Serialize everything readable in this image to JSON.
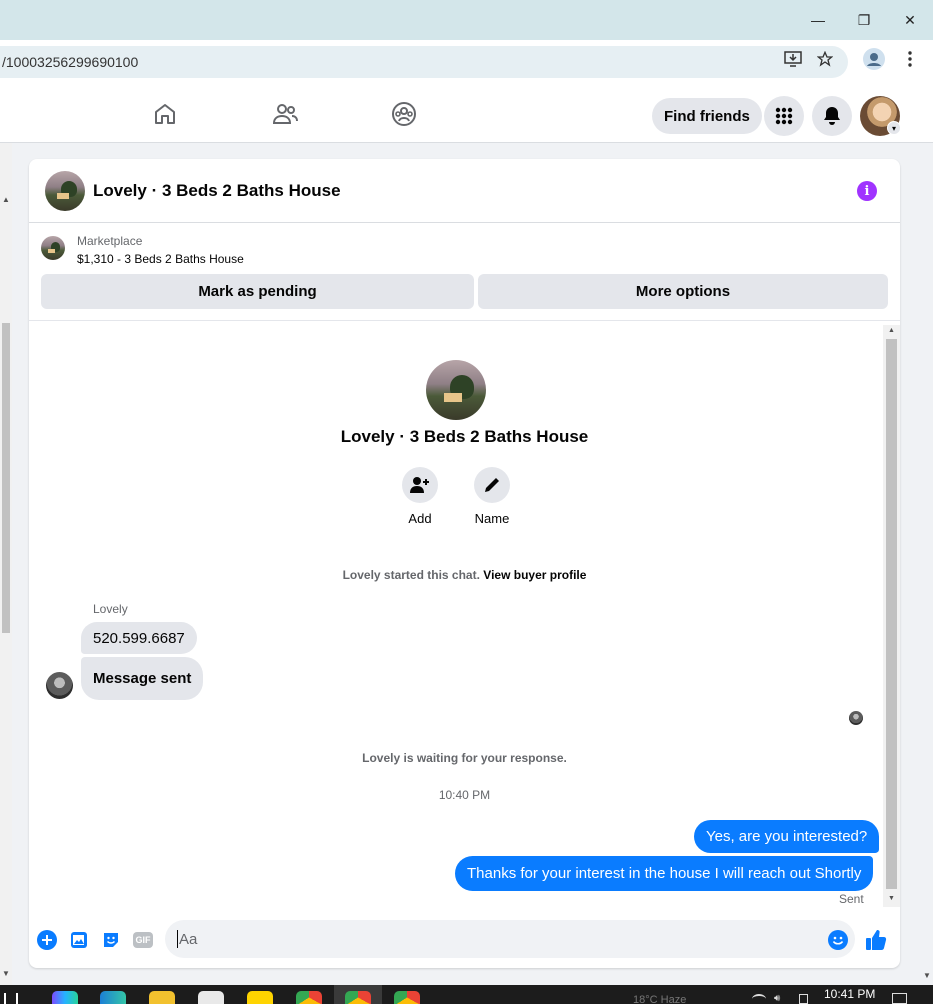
{
  "browser": {
    "url": "/10003256299690100",
    "window_controls": {
      "minimize": "—",
      "restore": "❐",
      "close": "✕"
    }
  },
  "fb_nav": {
    "find_friends_label": "Find friends"
  },
  "chat": {
    "title": "Lovely · 3 Beds 2 Baths House",
    "marketplace": {
      "label": "Marketplace",
      "listing": "$1,310 - 3 Beds 2 Baths House",
      "mark_pending_label": "Mark as pending",
      "more_options_label": "More options"
    },
    "profile": {
      "name": "Lovely · 3 Beds 2 Baths House",
      "add_label": "Add",
      "name_label": "Name"
    },
    "started_text": "Lovely started this chat.",
    "view_buyer_profile": "View buyer profile",
    "sender_name": "Lovely",
    "incoming": [
      "520.599.6687",
      "Message sent"
    ],
    "waiting_text": "Lovely is waiting for your response.",
    "timestamp": "10:40 PM",
    "outgoing": [
      "Yes, are you interested?",
      "Thanks for your interest in the house I will reach out Shortly"
    ],
    "status": "Sent",
    "composer_placeholder": "Aa",
    "gif_label": "GIF"
  },
  "taskbar": {
    "clock": "10:41 PM",
    "weather": "18°C  Haze"
  },
  "colors": {
    "accent": "#0a7cff",
    "info": "#a033ff",
    "bubble_in": "#e4e6eb"
  }
}
